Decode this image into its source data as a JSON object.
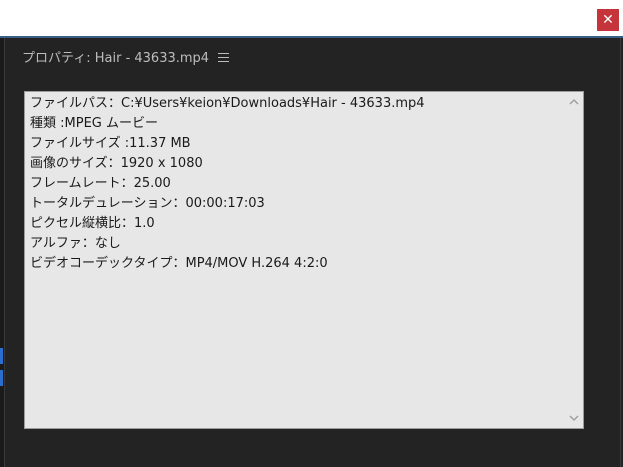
{
  "window": {
    "close_glyph": "✕"
  },
  "panel": {
    "title": "プロパティ: Hair - 43633.mp4"
  },
  "properties": [
    "ファイルパス：C:¥Users¥keion¥Downloads¥Hair - 43633.mp4",
    "種類 :MPEG ムービー",
    "ファイルサイズ :11.37 MB",
    "画像のサイズ：1920 x 1080",
    "フレームレート：25.00",
    "トータルデュレーション：00:00:17:03",
    "ピクセル縦横比：1.0",
    "アルファ：なし",
    "ビデオコーデックタイプ：MP4/MOV H.264 4:2:0"
  ],
  "colors": {
    "accent": "#3a5f87",
    "close": "#c4343a",
    "panel_bg": "#232323"
  },
  "icons": {
    "close": "close-icon",
    "menu": "hamburger-menu-icon",
    "scroll_up": "chevron-up-icon",
    "scroll_down": "chevron-down-icon"
  }
}
